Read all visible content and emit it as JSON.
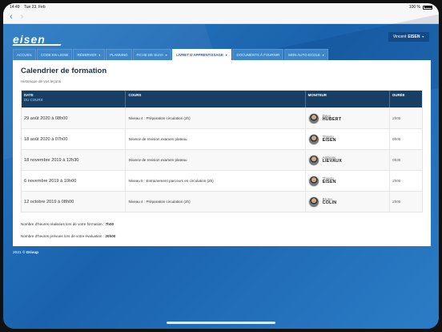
{
  "status": {
    "time": "14:49",
    "date": "Tue 23. Feb",
    "battery": "100 %"
  },
  "brand": {
    "logo": "eisen"
  },
  "user": {
    "prefix": "Vincent",
    "name": "EISEN"
  },
  "tabs": [
    {
      "label": "ACCUEIL",
      "caret": false
    },
    {
      "label": "CODE EN LIGNE",
      "caret": false
    },
    {
      "label": "RÉSERVER",
      "caret": true
    },
    {
      "label": "PLANNING",
      "caret": false
    },
    {
      "label": "FICHE DE SUIVI",
      "caret": true
    },
    {
      "label": "LIVRET D'APPRENTISSAGE",
      "caret": true
    },
    {
      "label": "DOCUMENTS À FOURNIR",
      "caret": false
    },
    {
      "label": "MON AUTO-ECOLE",
      "caret": true
    }
  ],
  "page": {
    "title": "Calendrier de formation",
    "subtitle": "Historique de vos leçons"
  },
  "table": {
    "headers": {
      "date": "DATE",
      "date_sub": "DU COURS",
      "course": "COURS",
      "teacher": "MONITEUR",
      "duration": "DURÉE"
    },
    "rows": [
      {
        "date": "29 août 2020 à 08h00",
        "course": "Niveau 4 : Préparation circulation (2h)",
        "first": "Davy",
        "last": "HUBERT",
        "duration": "2h00"
      },
      {
        "date": "18 août 2020 à 07h00",
        "course": "Séance de revision examen plateau",
        "first": "Thierry",
        "last": "EISEN",
        "duration": "0h00"
      },
      {
        "date": "18 novembre 2019 à 12h30",
        "course": "Séance de revision examen plateau",
        "first": "Anthony",
        "last": "LIEVAUX",
        "duration": "0h30"
      },
      {
        "date": "6 novembre 2019 à 10h00",
        "course": "Niveau 5 : Entrainement parcours en circulation (2h)",
        "first": "Thierry",
        "last": "EISEN",
        "duration": "2h00"
      },
      {
        "date": "12 octobre 2019 à 08h00",
        "course": "Niveau 4 : Préparation circulation (2h)",
        "first": "Bruno",
        "last": "COLIN",
        "duration": "2h00"
      }
    ]
  },
  "summary": {
    "done_label": "Nombre d'heures réalisées lors de votre formation :",
    "done_value": "7h00",
    "planned_label": "Nombre d'heures prévues lors de votre évaluation :",
    "planned_value": "20h00"
  },
  "footer": {
    "year": "2021 ©",
    "brand": "Drivup"
  },
  "colors": {
    "accent": "#1b5fa6",
    "header_bg": "#173e63",
    "page_bg": "#1f6bb4"
  },
  "icons": {
    "back": "chevron-left-icon",
    "forward": "chevron-right-icon"
  }
}
